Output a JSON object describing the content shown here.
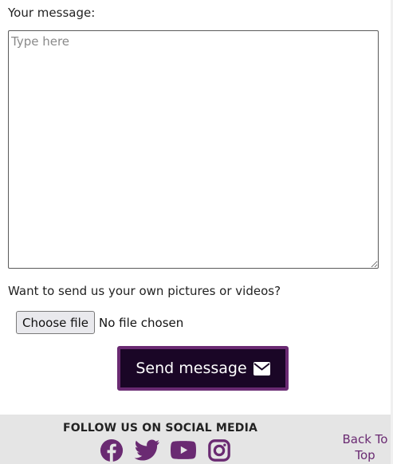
{
  "form": {
    "message_label": "Your message:",
    "message_placeholder": "Type here",
    "message_value": "",
    "upload_label": "Want to send us your own pictures or videos?",
    "choose_file_label": "Choose file",
    "file_status": "No file chosen",
    "send_label": "Send message",
    "send_icon": "envelope-icon"
  },
  "footer": {
    "follow_title": "FOLLOW US ON SOCIAL MEDIA",
    "social_icons": [
      "facebook-icon",
      "twitter-icon",
      "youtube-icon",
      "instagram-icon"
    ],
    "back_to_top_line1": "Back To",
    "back_to_top_line2": "Top"
  },
  "colors": {
    "accent": "#6a2a72",
    "button_bg": "#1a0626",
    "footer_bg": "#e5e5e5"
  }
}
